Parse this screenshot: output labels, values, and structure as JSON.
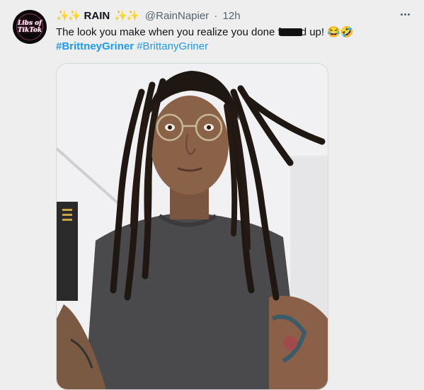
{
  "tweet": {
    "display_name": "RAIN",
    "handle": "@RainNapier",
    "separator": "·",
    "time": "12h",
    "text_before": "The look you make when you realize you done f",
    "text_after": "d up! ",
    "emoji": "😂🤣",
    "hashtags": [
      "#BrittneyGriner",
      "#BrittanyGriner"
    ]
  },
  "avatar": {
    "line1": "Libs of",
    "line2": "TikTok"
  },
  "icons": {
    "sparkles": "sparkles-icon",
    "more": "more-options-icon"
  },
  "colors": {
    "background": "#eeeeee",
    "link": "#1d9bf0",
    "secondary_text": "#536471",
    "sparkle": "#f6b83a"
  }
}
